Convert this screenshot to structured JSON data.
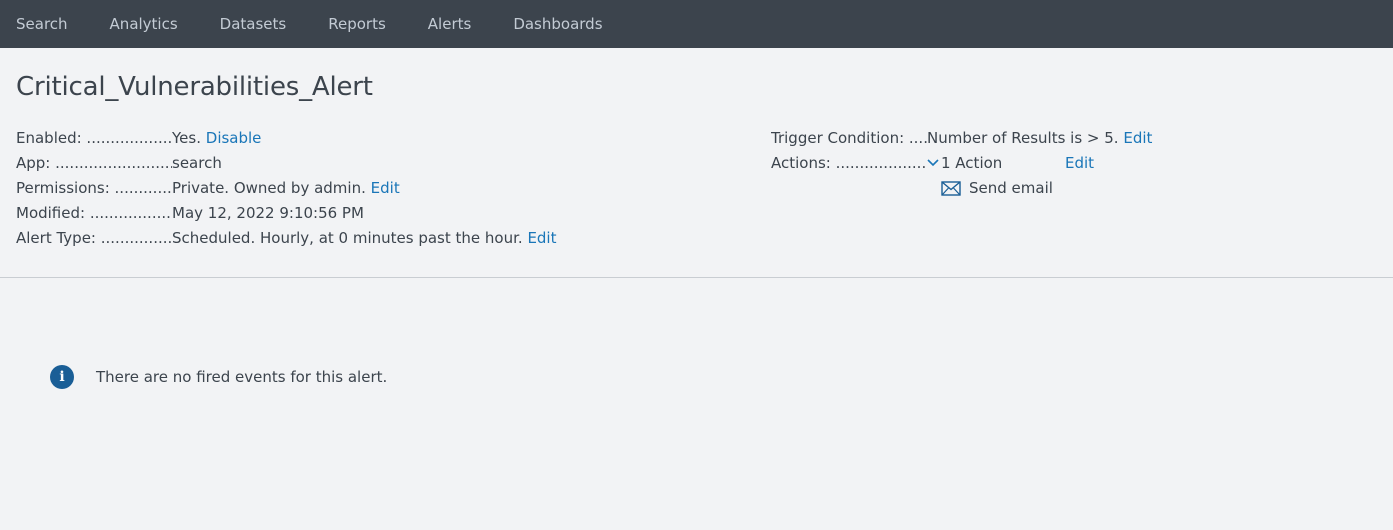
{
  "nav": {
    "items": [
      {
        "label": "Search"
      },
      {
        "label": "Analytics"
      },
      {
        "label": "Datasets"
      },
      {
        "label": "Reports"
      },
      {
        "label": "Alerts"
      },
      {
        "label": "Dashboards"
      }
    ]
  },
  "alert": {
    "title": "Critical_Vulnerabilities_Alert",
    "enabled": {
      "label": "Enabled: .........................................",
      "value": "Yes.",
      "link": "Disable"
    },
    "app": {
      "label": "App: ........................................................",
      "value": "search"
    },
    "permissions": {
      "label": "Permissions: ..................................",
      "value": "Private. Owned by admin.",
      "link": "Edit"
    },
    "modified": {
      "label": "Modified: .....................................",
      "value": "May 12, 2022 9:10:56 PM"
    },
    "alert_type": {
      "label": "Alert Type: ..................................",
      "value": "Scheduled. Hourly, at 0 minutes past the hour.",
      "link": "Edit"
    },
    "trigger": {
      "label": "Trigger Condition: ..........",
      "value": "Number of Results is > 5.",
      "link": "Edit"
    },
    "actions": {
      "label": "Actions: .........................................",
      "count": "1 Action",
      "link": "Edit",
      "sub_action": "Send email",
      "chevron_icon": "chevron-down-icon",
      "sub_icon": "envelope-icon"
    }
  },
  "fired_events": {
    "message": "There are no fired events for this alert.",
    "icon": "info-icon"
  },
  "colors": {
    "nav_bg": "#3c444d",
    "link": "#1a76b8",
    "info_icon": "#1a5e96",
    "page_bg": "#f2f3f5"
  }
}
